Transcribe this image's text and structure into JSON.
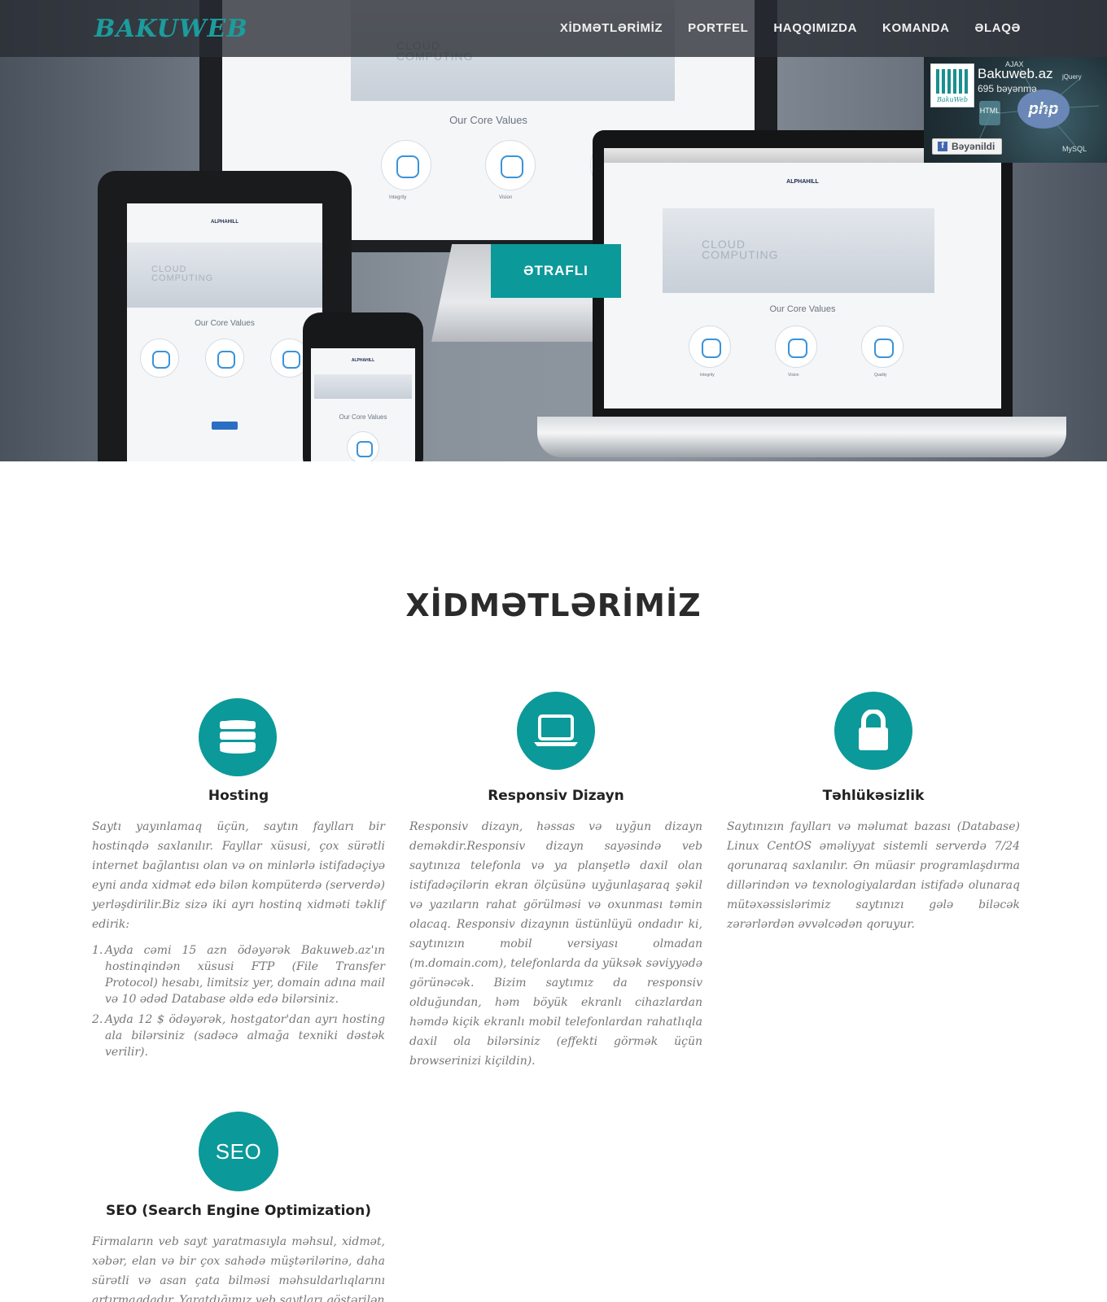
{
  "header": {
    "brand": "BAKUWEB",
    "nav": [
      "XİDMƏTLƏRİMİZ",
      "PORTFEL",
      "HAQQIMIZDA",
      "KOMANDA",
      "ƏLAQƏ"
    ]
  },
  "hero": {
    "button_label": "ƏTRAFLI",
    "mockup": {
      "cloud_line1": "CLOUD",
      "cloud_line2": "COMPUTING",
      "core_values": "Our Core Values",
      "value_labels": [
        "Integrity",
        "Vision",
        "Quality"
      ],
      "logo_text": "ALPHAHILL"
    }
  },
  "facebook": {
    "page_name": "Bakuweb.az",
    "likes": "695 bəyənmə",
    "like_button": "Bəyənildi",
    "logo_caption": "BakuWeb",
    "tech_labels": [
      "AJAX",
      "jQuery",
      "php",
      "HTML",
      "MySQL"
    ]
  },
  "services": {
    "title": "XİDMƏTLƏRİMİZ",
    "items": [
      {
        "title": "Hosting",
        "icon": "database-icon",
        "text": "Saytı yayınlamaq üçün, saytın faylları bir hostinqdə saxlanılır. Fayllar xüsusi, çox sürətli internet bağlantısı olan və on minlərlə istifadəçiyə eyni anda xidmət edə bilən kompüterdə (serverdə) yerləşdirilir.Biz sizə iki ayrı hostinq xidməti təklif edirik:",
        "list": [
          "Ayda cəmi 15 azn ödəyərək Bakuweb.az'ın hostinqindən xüsusi FTP (File Transfer Protocol) hesabı, limitsiz yer, domain adına mail və 10 ədəd Database əldə edə bilərsiniz.",
          "Ayda 12 $ ödəyərək, hostgator'dan ayrı hosting ala bilərsiniz (sadəcə almağa texniki dəstək verilir)."
        ]
      },
      {
        "title": "Responsiv Dizayn",
        "icon": "laptop-icon",
        "text": "Responsiv dizayn, həssas və uyğun dizayn deməkdir.Responsiv dizayn sayəsində veb saytınıza telefonla və ya planşetlə daxil olan istifadəçilərin ekran ölçüsünə uyğunlaşaraq şəkil və yazıların rahat görülməsi və oxunması təmin olacaq. Responsiv dizaynın üstünlüyü ondadır ki, saytınızın mobil versiyası olmadan (m.domain.com), telefonlarda da yüksək səviyyədə görünəcək. Bizim saytımız da responsiv olduğundan, həm böyük ekranlı cihazlardan həmdə kiçik ekranlı mobil telefonlardan rahatlıqla daxil ola bilərsiniz (effekti görmək üçün browserinizi kiçildin)."
      },
      {
        "title": "Təhlükəsizlik",
        "icon": "lock-icon",
        "text": "Saytınızın faylları və məlumat bazası (Database) Linux CentOS əməliyyat sistemli serverdə 7/24 qorunaraq saxlanılır. Ən müasir programlaşdırma dillərindən və texnologiyalardan istifadə olunaraq mütəxəssislərimiz saytınızı gələ biləcək zərərlərdən əvvəlcədən qoruyur."
      },
      {
        "title": "SEO (Search Engine Optimization)",
        "icon": "seo-icon",
        "icon_text": "SEO",
        "text": "Firmaların veb sayt yaratmasıyla məhsul, xidmət, xəbər, elan və bir çox sahədə müştərilərinə, daha sürətli və asan çata bilməsi məhsuldarlıqlarını artırmaqdadır. Yaratdığımız veb saytları göstərilən"
      }
    ]
  },
  "colors": {
    "accent": "#0c9999",
    "brand": "#1c9c9c",
    "nav_bg": "#282c32",
    "body_text": "#777777"
  }
}
